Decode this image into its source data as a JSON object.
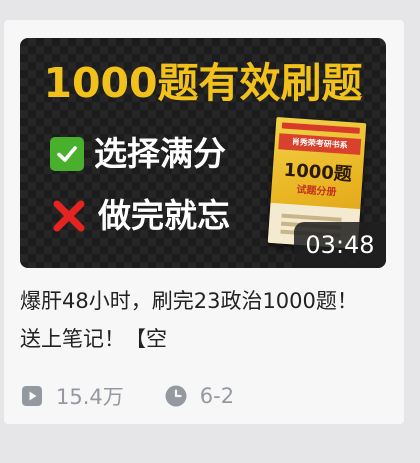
{
  "video": {
    "thumbnail": {
      "headline": "1000题有效刷题",
      "point_good": "选择满分",
      "point_bad": "做完就忘",
      "book": {
        "band": "肖秀荣考研书系",
        "title": "1000题",
        "subtitle": "试题分册"
      }
    },
    "duration": "03:48",
    "title": "爆肝48小时，刷完23政治1000题！送上笔记！【空",
    "views": "15.4万",
    "date": "6-2"
  },
  "icons": {
    "views": "play-count-icon",
    "date": "clock-icon",
    "good": "check-icon",
    "bad": "cross-icon"
  },
  "colors": {
    "headline": "#f3c21a",
    "check": "#48b02c",
    "cross": "#e52420",
    "meta": "#9499a0"
  }
}
